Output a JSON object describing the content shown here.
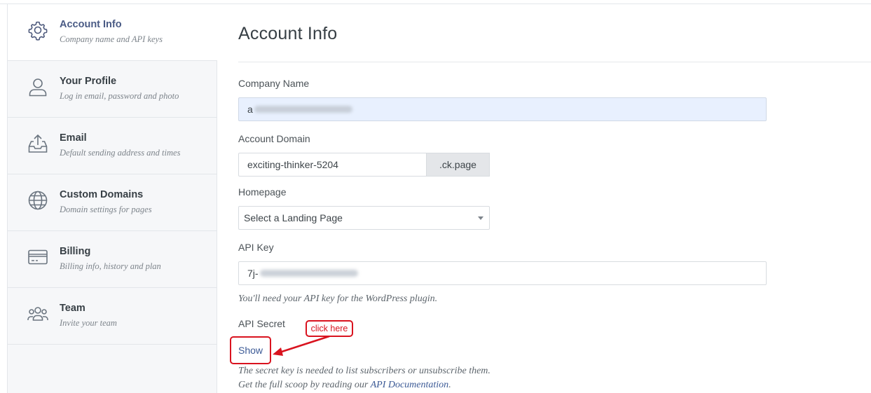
{
  "sidebar": {
    "items": [
      {
        "label": "Account Info",
        "sub": "Company name and API keys",
        "icon": "settings-gear-icon",
        "active": true
      },
      {
        "label": "Your Profile",
        "sub": "Log in email, password and photo",
        "icon": "user-icon"
      },
      {
        "label": "Email",
        "sub": "Default sending address and times",
        "icon": "inbox-upload-icon"
      },
      {
        "label": "Custom Domains",
        "sub": "Domain settings for pages",
        "icon": "globe-icon"
      },
      {
        "label": "Billing",
        "sub": "Billing info, history and plan",
        "icon": "credit-card-icon"
      },
      {
        "label": "Team",
        "sub": "Invite your team",
        "icon": "team-icon"
      }
    ]
  },
  "main": {
    "title": "Account Info",
    "company_name": {
      "label": "Company Name",
      "value": "a"
    },
    "account_domain": {
      "label": "Account Domain",
      "value": "exciting-thinker-5204",
      "suffix": ".ck.page"
    },
    "homepage": {
      "label": "Homepage",
      "selected": "Select a Landing Page"
    },
    "api_key": {
      "label": "API Key",
      "value": "7j-",
      "help": "You'll need your API key for the WordPress plugin."
    },
    "api_secret": {
      "label": "API Secret",
      "show_label": "Show",
      "help_line1": "The secret key is needed to list subscribers or unsubscribe them.",
      "help_line2_prefix": "Get the full scoop by reading our",
      "help_link": "API Documentation",
      "help_line2_suffix": "."
    }
  },
  "annotation": {
    "text": "click here",
    "color": "#d9131f"
  }
}
